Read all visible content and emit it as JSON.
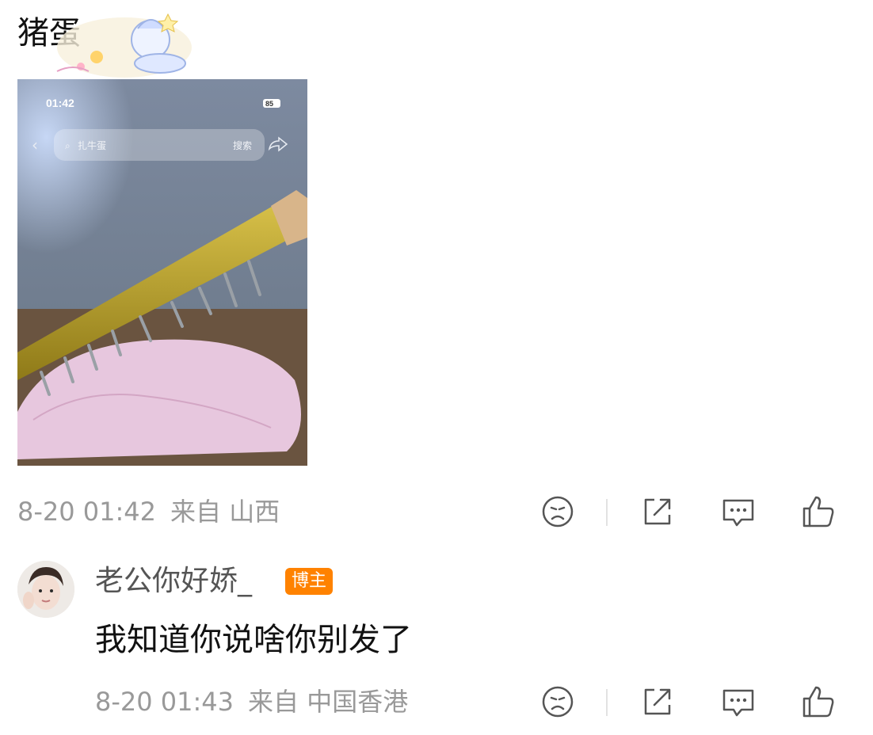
{
  "post": {
    "text": "猪蛋",
    "meta": {
      "time": "8-20 01:42",
      "source": "来自 山西"
    }
  },
  "screenshot": {
    "time": "01:42",
    "battery": "85",
    "search_placeholder": "扎牛蛋",
    "search_button": "搜索"
  },
  "comment": {
    "username": "老公你好娇_",
    "badge": "博主",
    "text": "我知道你说啥你别发了",
    "meta": {
      "time": "8-20 01:43",
      "source": "来自 中国香港"
    }
  },
  "colors": {
    "badge": "#ff8200",
    "meta": "#999999",
    "icon": "#555555"
  },
  "icons": [
    "dislike-face-icon",
    "share-icon",
    "comment-icon",
    "like-thumb-icon"
  ]
}
